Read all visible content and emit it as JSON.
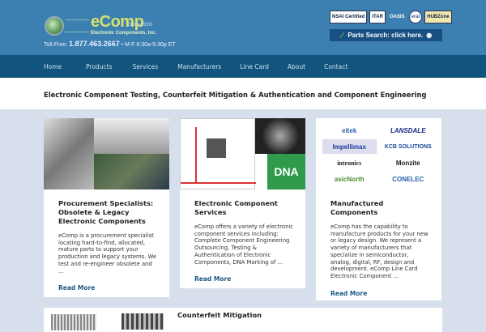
{
  "header": {
    "brand": "eComp",
    "since": "Since 2000",
    "subtitle": "Electronic Components, Inc.",
    "phone_label": "Toll-Free:",
    "phone": "1.877.463.2667",
    "hours": "• M-F 8:30a-5:30p ET",
    "certs": [
      "NSAI Certified",
      "ITAR",
      "OASIS",
      "erai",
      "HUBZone"
    ],
    "parts_search": "Parts Search: click here."
  },
  "nav": [
    "Home",
    "Products",
    "Services",
    "Manufacturers",
    "Line Card",
    "About",
    "Contact"
  ],
  "banner": {
    "title": "Electronic Component Testing, Counterfeit Mitigation & Authentication and Component Engineering"
  },
  "cards": [
    {
      "title": "Procurement Specialists: Obsolete & Legacy Electronic Components",
      "text": "eComp is a procurement specialist locating hard-to-find, allocated, mature parts to support your production and legacy systems. We test and re-engineer obsolete and ...",
      "link": "Read More"
    },
    {
      "title": "Electronic Component Services",
      "text": "eComp offers a variety of electronic component services including: Complete Component Engineering Outsourcing, Testing & Authentication of Electronic Components, DNA Marking of ...",
      "link": "Read More",
      "image_text": "DNA"
    },
    {
      "title": "Manufactured Components",
      "text": "eComp has the capability to manufacture products for your new or legacy design.  We represent a variety of manufacturers that specialize in semiconductor, analog, digital, RF, design and development. eComp Line Card Electronic Component ...",
      "link": "Read More",
      "logos": [
        "eltek",
        "LANSDALE",
        "Impellimax",
        "KCB SOLUTIONS",
        "intronics",
        "Monzite",
        "asicNorth",
        "CONELEC"
      ]
    }
  ],
  "bottom": {
    "title": "Counterfeit Mitigation"
  }
}
